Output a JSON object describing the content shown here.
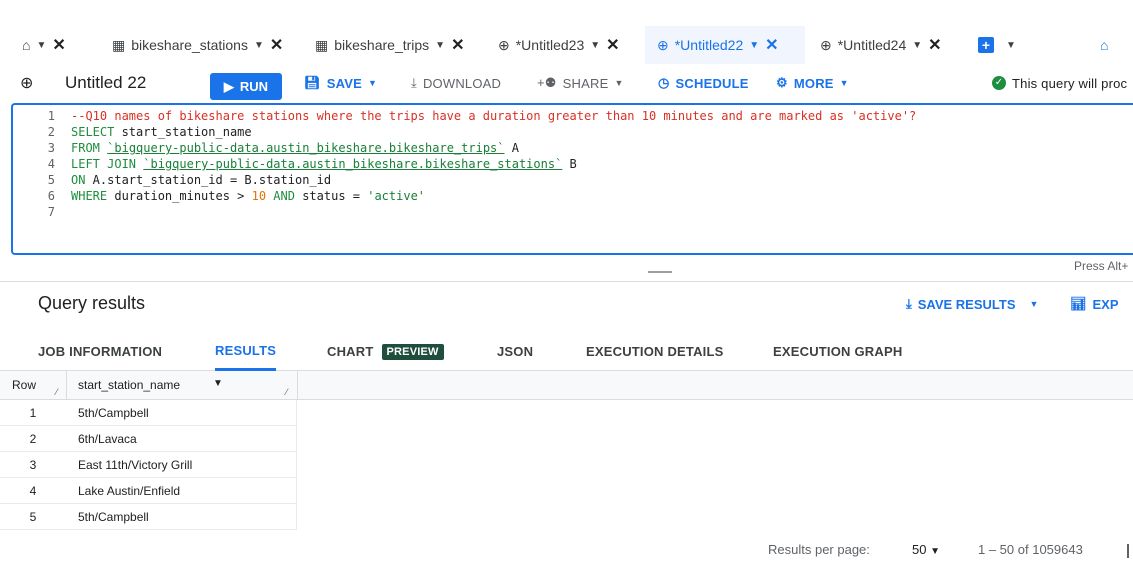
{
  "tabs": [
    {
      "label": "",
      "icon": "home-icon"
    },
    {
      "label": "bikeshare_stations",
      "icon": "table-icon"
    },
    {
      "label": "bikeshare_trips",
      "icon": "table-icon"
    },
    {
      "label": "*Untitled23",
      "icon": "query-icon"
    },
    {
      "label": "*Untitled22",
      "icon": "query-icon"
    },
    {
      "label": "*Untitled24",
      "icon": "query-icon"
    }
  ],
  "toolbar": {
    "title": "Untitled 22",
    "run": "RUN",
    "save": "SAVE",
    "download": "DOWNLOAD",
    "share": "SHARE",
    "schedule": "SCHEDULE",
    "more": "MORE",
    "status": "This query will proc"
  },
  "editor": {
    "line_numbers": [
      "1",
      "2",
      "3",
      "4",
      "5",
      "6",
      "7"
    ],
    "comment": "--Q10 names of bikeshare stations where the trips have a duration greater than 10 minutes and are marked as 'active'?",
    "l2_kw": "SELECT",
    "l2_rest": " start_station_name",
    "l3_kw": "FROM",
    "l3_str": "`bigquery-public-data.austin_bikeshare.bikeshare_trips`",
    "l3_rest": " A",
    "l4_kw": "LEFT JOIN",
    "l4_str": "`bigquery-public-data.austin_bikeshare.bikeshare_stations`",
    "l4_rest": " B",
    "l5_kw": "ON",
    "l5_rest": " A.start_station_id = B.station_id",
    "l6_kw": "WHERE",
    "l6_a": " duration_minutes > ",
    "l6_num": "10",
    "l6_and": " AND",
    "l6_b": " status = ",
    "l6_lit": "'active'",
    "hint": "Press Alt+"
  },
  "results": {
    "title": "Query results",
    "save_results": "SAVE RESULTS",
    "explore": "EXP",
    "tabs": [
      "JOB INFORMATION",
      "RESULTS",
      "CHART",
      "JSON",
      "EXECUTION DETAILS",
      "EXECUTION GRAPH"
    ],
    "preview_badge": "PREVIEW",
    "col_row": "Row",
    "col_name": "start_station_name",
    "rows": [
      {
        "n": "1",
        "name": "5th/Campbell"
      },
      {
        "n": "2",
        "name": "6th/Lavaca"
      },
      {
        "n": "3",
        "name": "East 11th/Victory Grill"
      },
      {
        "n": "4",
        "name": "Lake Austin/Enfield"
      },
      {
        "n": "5",
        "name": "5th/Campbell"
      }
    ]
  },
  "footer": {
    "per_page_label": "Results per page:",
    "per_page_value": "50",
    "range": "1 – 50 of 1059643"
  },
  "colors": {
    "accent": "#1a73e8",
    "comment": "#d93025",
    "keyword": "#1e8e3e",
    "number": "#e37400"
  }
}
